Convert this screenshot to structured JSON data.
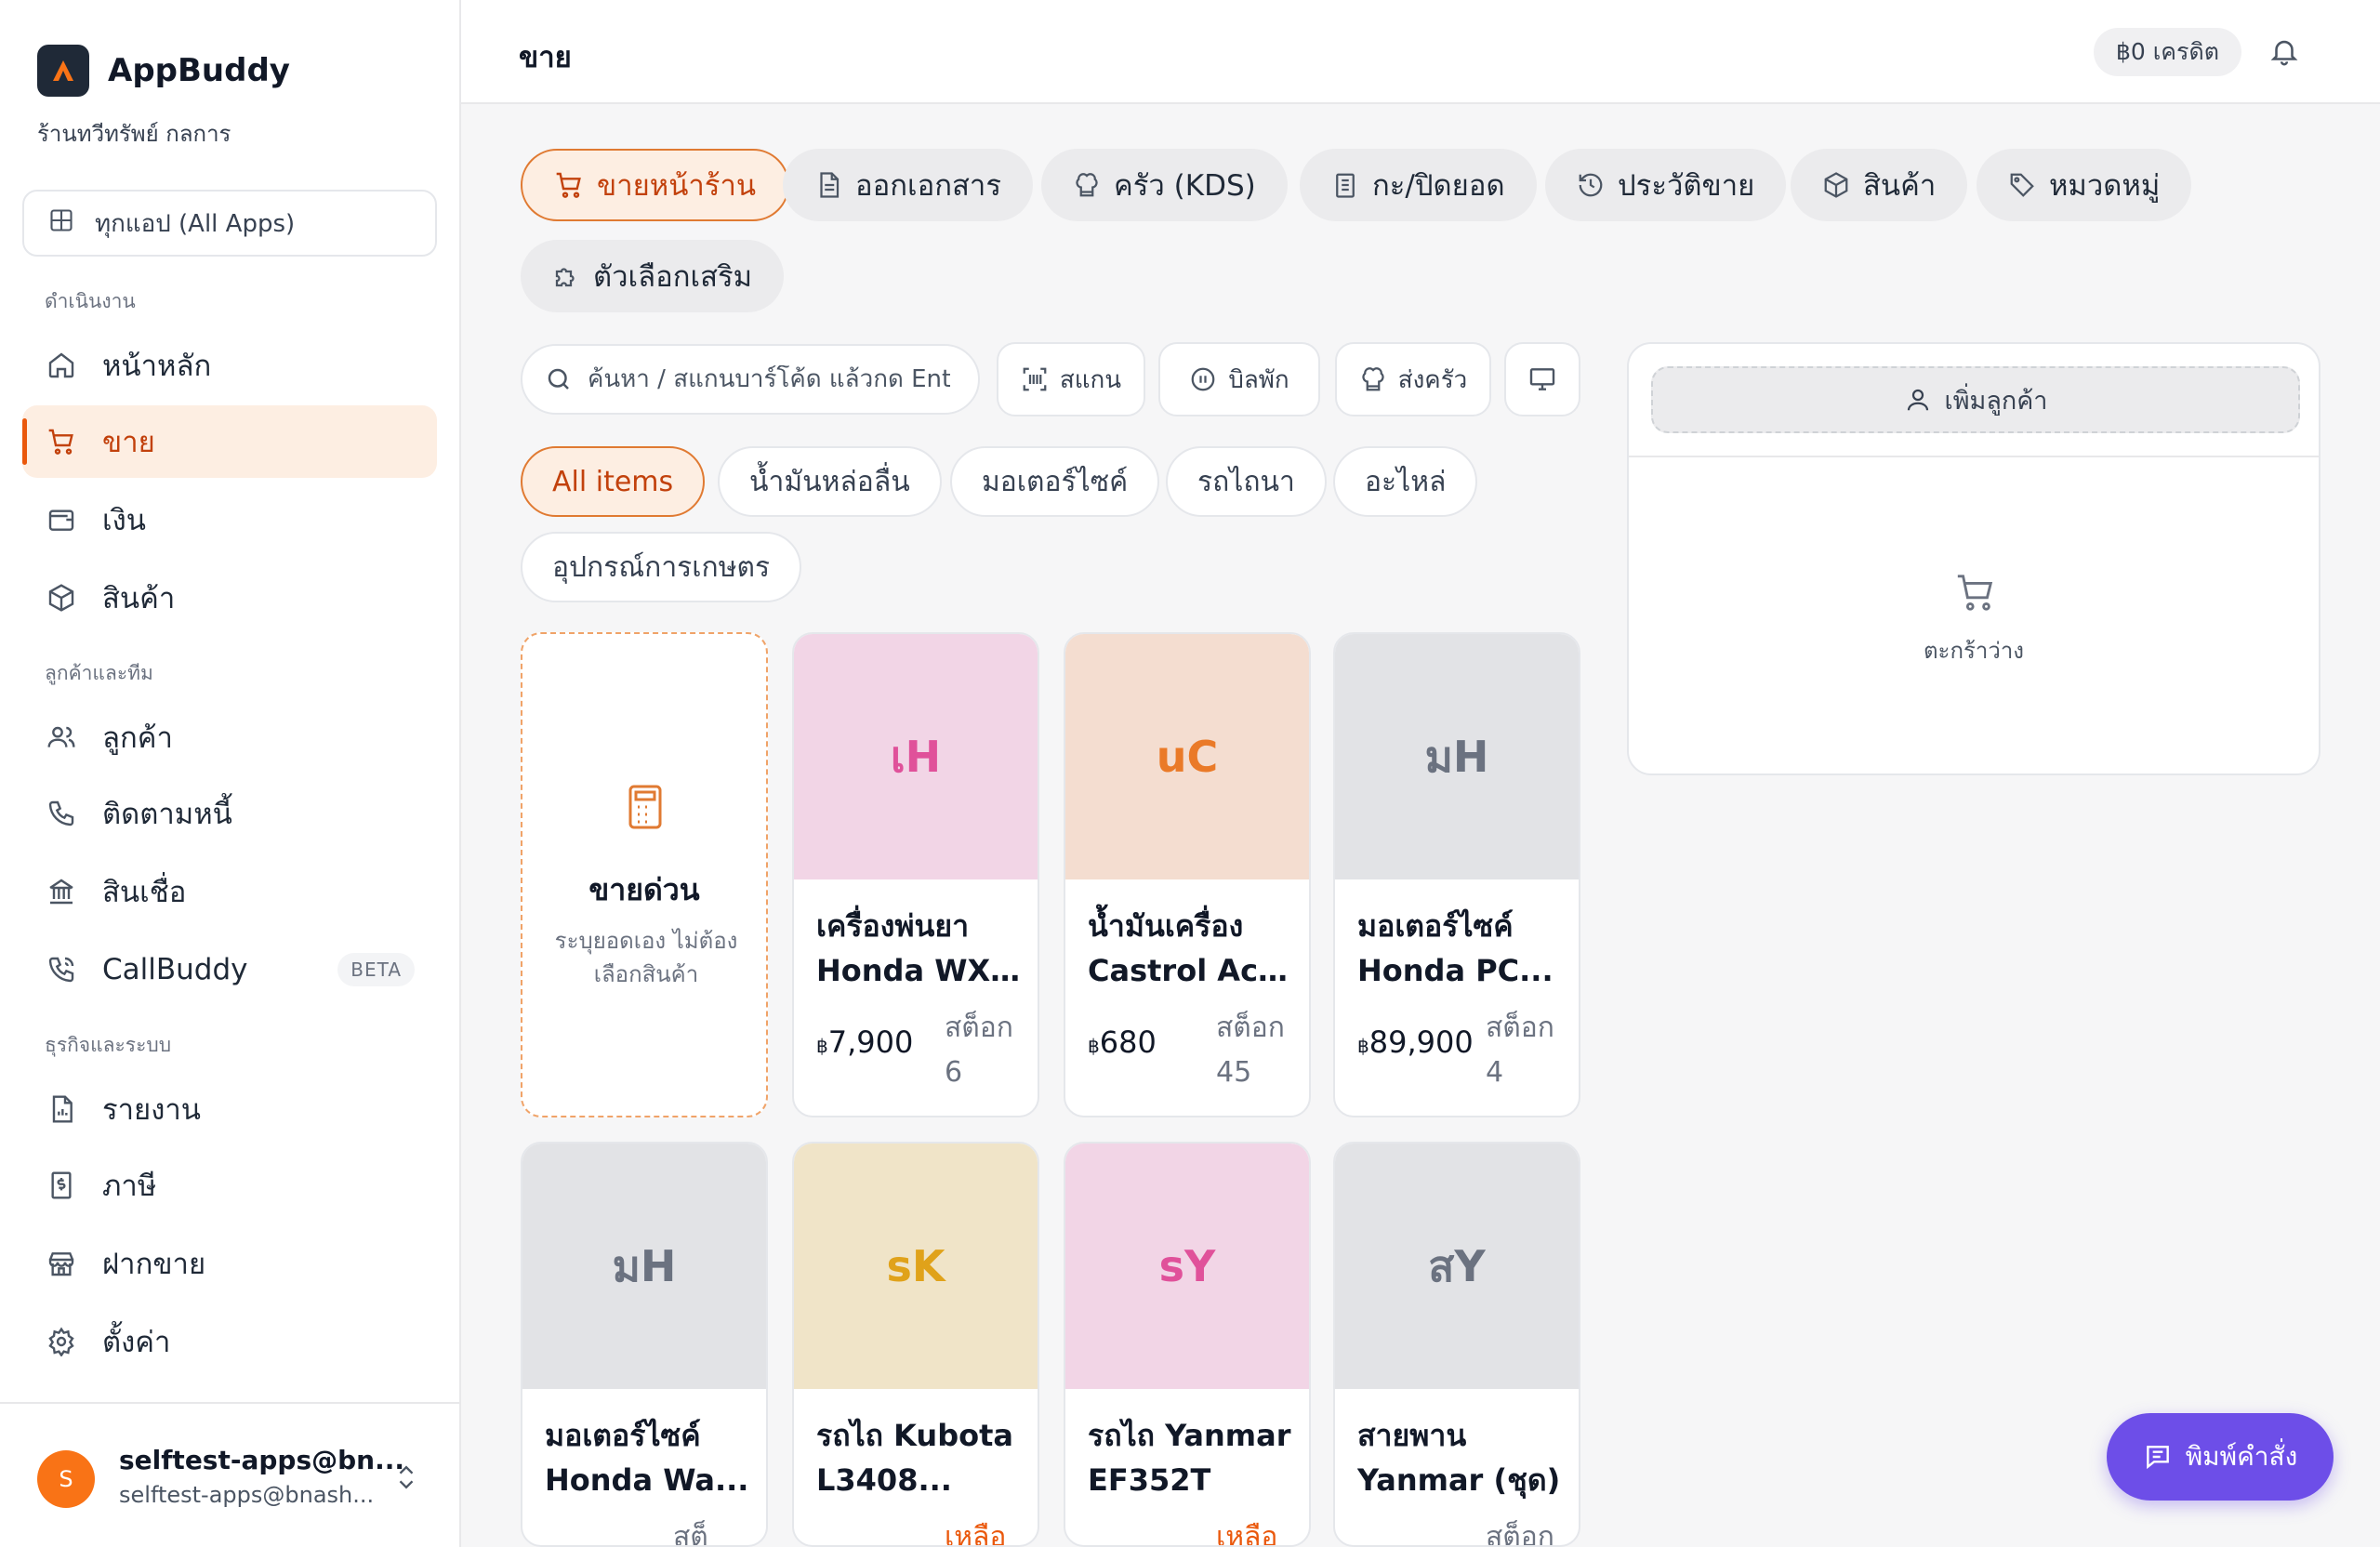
{
  "sidebar": {
    "brand": "AppBuddy",
    "shop": "ร้านทวีทรัพย์ กลการ",
    "all_apps": "ทุกแอป (All Apps)",
    "sections": {
      "operations": "ดำเนินงาน",
      "customers_team": "ลูกค้าและทีม",
      "business_system": "ธุรกิจและระบบ"
    },
    "items": [
      {
        "label": "หน้าหลัก",
        "icon": "home-icon"
      },
      {
        "label": "ขาย",
        "icon": "cart-icon",
        "active": true
      },
      {
        "label": "เงิน",
        "icon": "wallet-icon"
      },
      {
        "label": "สินค้า",
        "icon": "box-icon"
      },
      {
        "label": "ลูกค้า",
        "icon": "users-icon"
      },
      {
        "label": "ติดตามหนี้",
        "icon": "phone-icon"
      },
      {
        "label": "สินเชื่อ",
        "icon": "bank-icon"
      },
      {
        "label": "CallBuddy",
        "icon": "phone-call-icon",
        "badge": "BETA"
      },
      {
        "label": "รายงาน",
        "icon": "report-icon"
      },
      {
        "label": "ภาษี",
        "icon": "tax-icon"
      },
      {
        "label": "ฝากขาย",
        "icon": "store-icon"
      },
      {
        "label": "ตั้งค่า",
        "icon": "gear-icon"
      }
    ],
    "user": {
      "initial": "S",
      "name": "selftest-apps@bn...",
      "email": "selftest-apps@bnash..."
    }
  },
  "header": {
    "title": "ขาย",
    "credit": "฿0 เครดิต"
  },
  "module_tabs": [
    {
      "label": "ขายหน้าร้าน",
      "icon": "cart-icon",
      "active": true
    },
    {
      "label": "ออกเอกสาร",
      "icon": "document-icon"
    },
    {
      "label": "ครัว (KDS)",
      "icon": "chef-hat-icon"
    },
    {
      "label": "กะ/ปิดยอด",
      "icon": "clipboard-icon"
    },
    {
      "label": "ประวัติขาย",
      "icon": "history-icon"
    },
    {
      "label": "สินค้า",
      "icon": "box-icon"
    },
    {
      "label": "หมวดหมู่",
      "icon": "tag-icon"
    },
    {
      "label": "ตัวเลือกเสริม",
      "icon": "puzzle-icon"
    }
  ],
  "toolbar": {
    "search_placeholder": "ค้นหา / สแกนบาร์โค้ด แล้วกด Enter",
    "scan": "สแกน",
    "hold_bill": "บิลพัก",
    "send_kitchen": "ส่งครัว"
  },
  "categories": [
    {
      "label": "All items",
      "active": true
    },
    {
      "label": "น้ำมันหล่อลื่น"
    },
    {
      "label": "มอเตอร์ไซค์"
    },
    {
      "label": "รถไถนา"
    },
    {
      "label": "อะไหล่"
    },
    {
      "label": "อุปกรณ์การเกษตร"
    }
  ],
  "quick_sale": {
    "title": "ขายด่วน",
    "subtitle": "ระบุยอดเอง ไม่ต้องเลือกสินค้า"
  },
  "products": [
    {
      "initials": "เH",
      "line1": "เครื่องพ่นยา",
      "line2": "Honda WX...",
      "currency": "฿",
      "price": "7,900",
      "stock": "สต็อก 6",
      "color": "#e0519a",
      "bg": "#f2d5e6"
    },
    {
      "initials": "uC",
      "line1": "น้ำมันเครื่อง",
      "line2": "Castrol Act...",
      "currency": "฿",
      "price": "680",
      "stock": "สต็อก 45",
      "color": "#ea7a28",
      "bg": "#f4ddd0"
    },
    {
      "initials": "มH",
      "line1": "มอเตอร์ไซค์",
      "line2": "Honda PC...",
      "currency": "฿",
      "price": "89,900",
      "stock": "สต็อก 4",
      "color": "#6b7280",
      "bg": "#e2e3e6"
    },
    {
      "initials": "มH",
      "line1": "มอเตอร์ไซค์",
      "line2": "Honda Wa...",
      "currency": "",
      "price": "",
      "stock": "สต็",
      "color": "#6b7280",
      "bg": "#e2e3e6"
    },
    {
      "initials": "sK",
      "line1": "รถไถ Kubota",
      "line2": "L3408...",
      "currency": "",
      "price": "",
      "stock": "เหลือ",
      "low": true,
      "color": "#e0a21a",
      "bg": "#f0e4c8"
    },
    {
      "initials": "sY",
      "line1": "รถไถ Yanmar",
      "line2": "EF352T",
      "currency": "",
      "price": "",
      "stock": "เหลือ",
      "low": true,
      "color": "#e0519a",
      "bg": "#f2d5e6"
    },
    {
      "initials": "สY",
      "line1": "สายพาน",
      "line2": "Yanmar (ชุด)",
      "currency": "",
      "price": "",
      "stock": "สต็อก",
      "color": "#6b7280",
      "bg": "#e2e3e6"
    }
  ],
  "cart": {
    "add_customer": "เพิ่มลูกค้า",
    "empty": "ตะกร้าว่าง"
  },
  "command_button": "พิมพ์คำสั่ง"
}
